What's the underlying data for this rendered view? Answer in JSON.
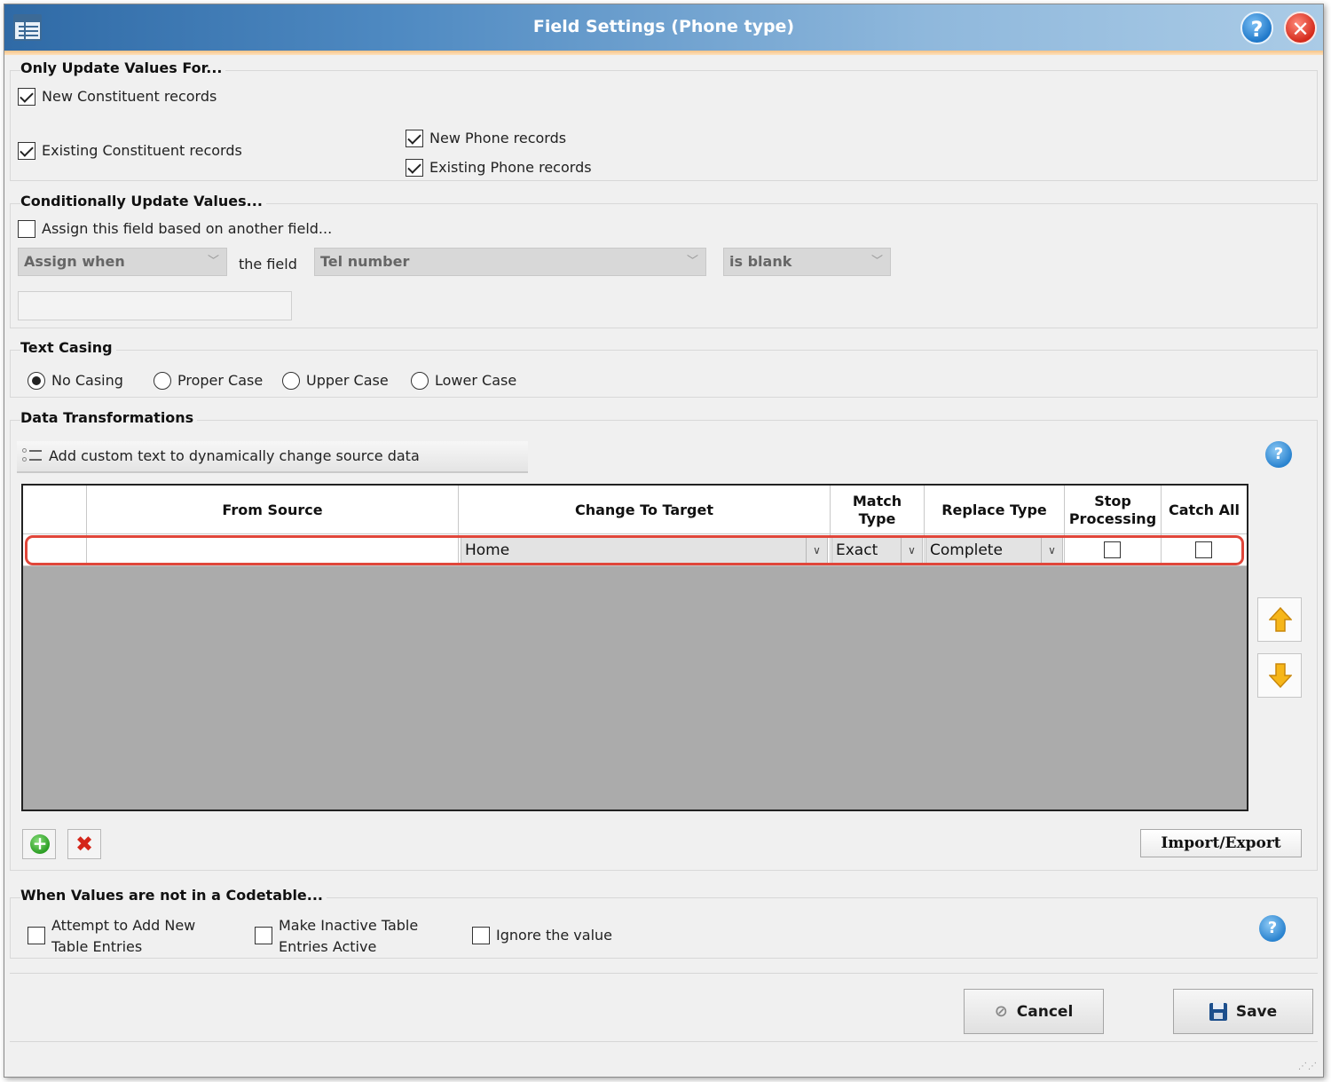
{
  "window": {
    "title": "Field Settings (Phone type)"
  },
  "only_update": {
    "heading": "Only Update Values For...",
    "new_constituent": {
      "label": "New Constituent records",
      "checked": true
    },
    "existing_constituent": {
      "label": "Existing Constituent records",
      "checked": true
    },
    "new_phone": {
      "label": "New Phone records",
      "checked": true
    },
    "existing_phone": {
      "label": "Existing Phone records",
      "checked": true
    }
  },
  "conditional": {
    "heading": "Conditionally Update Values...",
    "assign_label": "Assign this field based on another field...",
    "assign_checked": false,
    "assign_when": "Assign when",
    "the_field_label": "the field",
    "field_value": "Tel number",
    "condition_value": "is blank"
  },
  "text_casing": {
    "heading": "Text Casing",
    "options": [
      "No Casing",
      "Proper Case",
      "Upper Case",
      "Lower Case"
    ],
    "selected": "No Casing"
  },
  "transformations": {
    "heading": "Data Transformations",
    "custom_text_button": "Add custom text to dynamically change source data",
    "columns": [
      "From Source",
      "Change To Target",
      "Match Type",
      "Replace Type",
      "Stop Processing",
      "Catch All"
    ],
    "rows": [
      {
        "from_source": "",
        "change_to_target": "Home",
        "match_type": "Exact",
        "replace_type": "Complete",
        "stop_processing": false,
        "catch_all": false
      }
    ],
    "import_export": "Import/Export"
  },
  "codetable": {
    "heading": "When Values are not in a Codetable...",
    "attempt_add": {
      "label": "Attempt to Add New Table Entries",
      "checked": false
    },
    "make_active": {
      "label": "Make Inactive Table Entries Active",
      "checked": false
    },
    "ignore_value": {
      "label": "Ignore the value",
      "checked": false
    }
  },
  "footer": {
    "cancel": "Cancel",
    "save": "Save"
  },
  "colors": {
    "title_bar": "#4f8ac2",
    "highlight": "#e0463a",
    "grid_background": "#ababab"
  }
}
